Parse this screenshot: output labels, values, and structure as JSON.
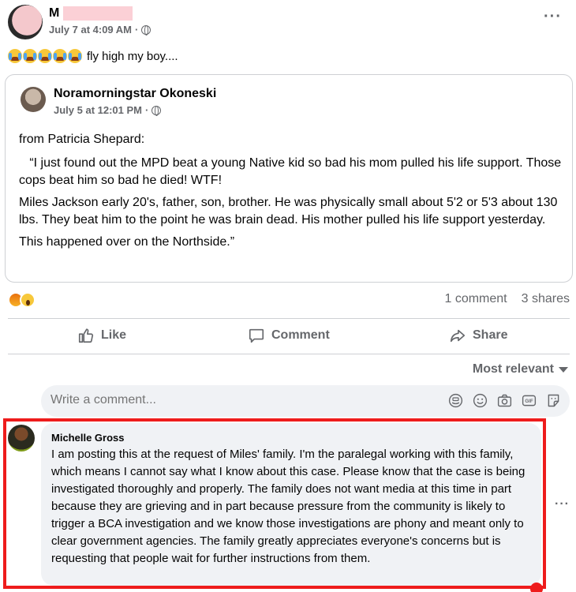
{
  "post": {
    "author_initial": "M",
    "timestamp": "July 7 at 4:09 AM",
    "privacy_separator": "·",
    "text": "fly high my boy....",
    "emoji_count": 5
  },
  "shared": {
    "author": "Noramorningstar Okoneski",
    "timestamp": "July 5 at 12:01 PM",
    "privacy_separator": "·",
    "paragraphs": [
      "from Patricia Shepard:",
      "   “I just found out the MPD beat a  young Native kid so bad his mom pulled his life support. Those cops beat him so bad he died!  WTF!",
      "Miles Jackson early 20's, father, son, brother.  He was physically small about 5'2 or 5'3 about 130 lbs.  They beat him to the point he was brain dead.  His mother pulled his life support yesterday.",
      "This happened over on the Northside.”"
    ]
  },
  "stats": {
    "comments": "1 comment",
    "shares": "3 shares"
  },
  "actions": {
    "like": "Like",
    "comment": "Comment",
    "share": "Share"
  },
  "filter": {
    "label": "Most relevant"
  },
  "composer": {
    "placeholder": "Write a comment..."
  },
  "comment": {
    "author": "Michelle Gross",
    "text": "I am posting this at the request of Miles' family. I'm the paralegal working with this family, which means I cannot say what I know about this case. Please know that the case is being investigated thoroughly and properly. The family does not want media at this time in part because they are grieving and in part because pressure from the community is likely to trigger a BCA investigation and we know those investigations are phony and meant only to clear government agencies. The family greatly appreciates everyone's concerns but is requesting that people wait for further instructions from them."
  },
  "colors": {
    "highlight": "#ee1c1c",
    "secondary_text": "#65676b",
    "bubble": "#f0f2f5"
  }
}
